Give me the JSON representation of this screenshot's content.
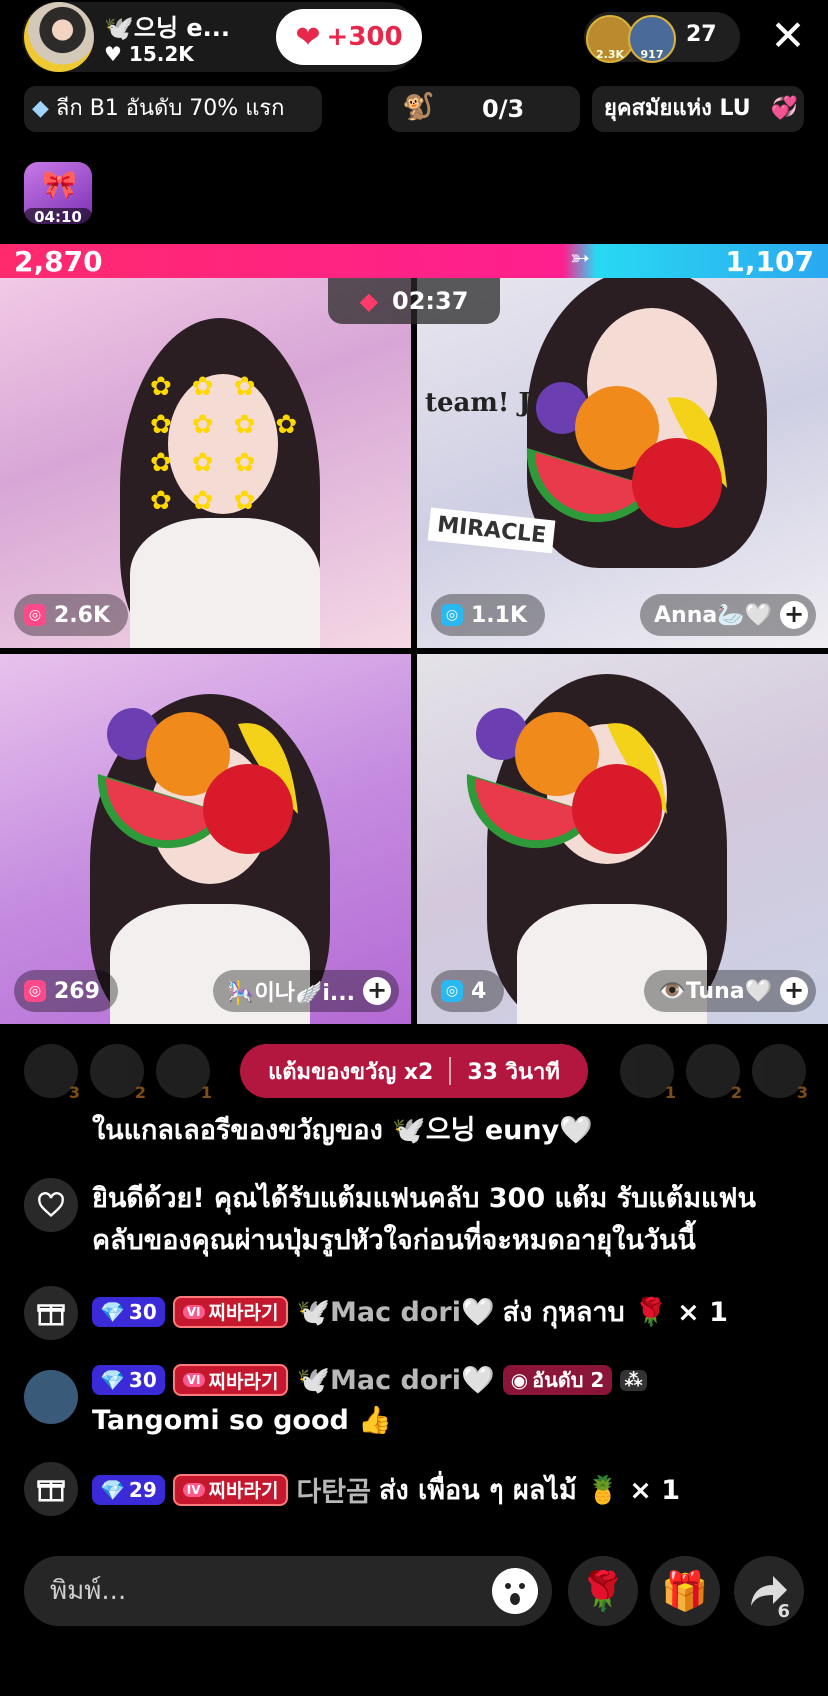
{
  "header": {
    "host_name": "🕊️으닝 e...",
    "host_likes": "15.2K",
    "like_button_label": "+300",
    "viewer_badges": [
      "2.3K",
      "917"
    ],
    "viewer_count": "27"
  },
  "info_bar": {
    "league_text": "ลีก B1 อันดับ 70% แรก",
    "quest_progress": "0/3",
    "era_text": "ยุคสมัยแห่ง LU"
  },
  "timer": "04:10",
  "battle": {
    "left_score": "2,870",
    "right_score": "1,107",
    "countdown": "02:37"
  },
  "tiles": [
    {
      "count": "2.6K",
      "name": ""
    },
    {
      "count": "1.1K",
      "name": "Anna🦢🤍"
    },
    {
      "count": "269",
      "name": "🎠이나🪽i..."
    },
    {
      "count": "4",
      "name": "👁️Tuna🤍"
    }
  ],
  "tile_overlay_texts": {
    "t2_sign": "team! Joi",
    "t2_board": "MIRACLE"
  },
  "multiplier": {
    "label": "แต้มของขวัญ x2",
    "time": "33 วินาที"
  },
  "rank_left": [
    "3",
    "2",
    "1"
  ],
  "rank_right": [
    "1",
    "2",
    "3"
  ],
  "chat": {
    "line1": "ในแกลเลอรีของขวัญของ 🕊️으닝 euny🤍",
    "line2a": "ยินดีด้วย! คุณได้รับแต้มแฟนคลับ 300 แต้ม รับแต้มแฟน",
    "line2b": "คลับของคุณผ่านปุ่มรูปหัวใจก่อนที่จะหมดอายุในวันนี้",
    "msg1": {
      "level": "30",
      "club": "찌바라기",
      "user": "🕊️Mac dori🤍",
      "action": "ส่ง กุหลาบ 🌹 × 1"
    },
    "msg2": {
      "level": "30",
      "club": "찌바라기",
      "user": "🕊️Mac dori🤍",
      "rank": "อันดับ 2",
      "text": "Tangomi so good 👍"
    },
    "msg3": {
      "level": "29",
      "club": "찌바라기",
      "user": "다탄곰",
      "action": "ส่ง เพื่อน ๆ ผลไม้ 🍍 × 1"
    }
  },
  "input": {
    "placeholder": "พิมพ์..."
  },
  "share_count": "6",
  "colors": {
    "pink": "#ff1f8f",
    "cyan": "#29d9f2",
    "multiplier_bg": "#b3173f"
  }
}
